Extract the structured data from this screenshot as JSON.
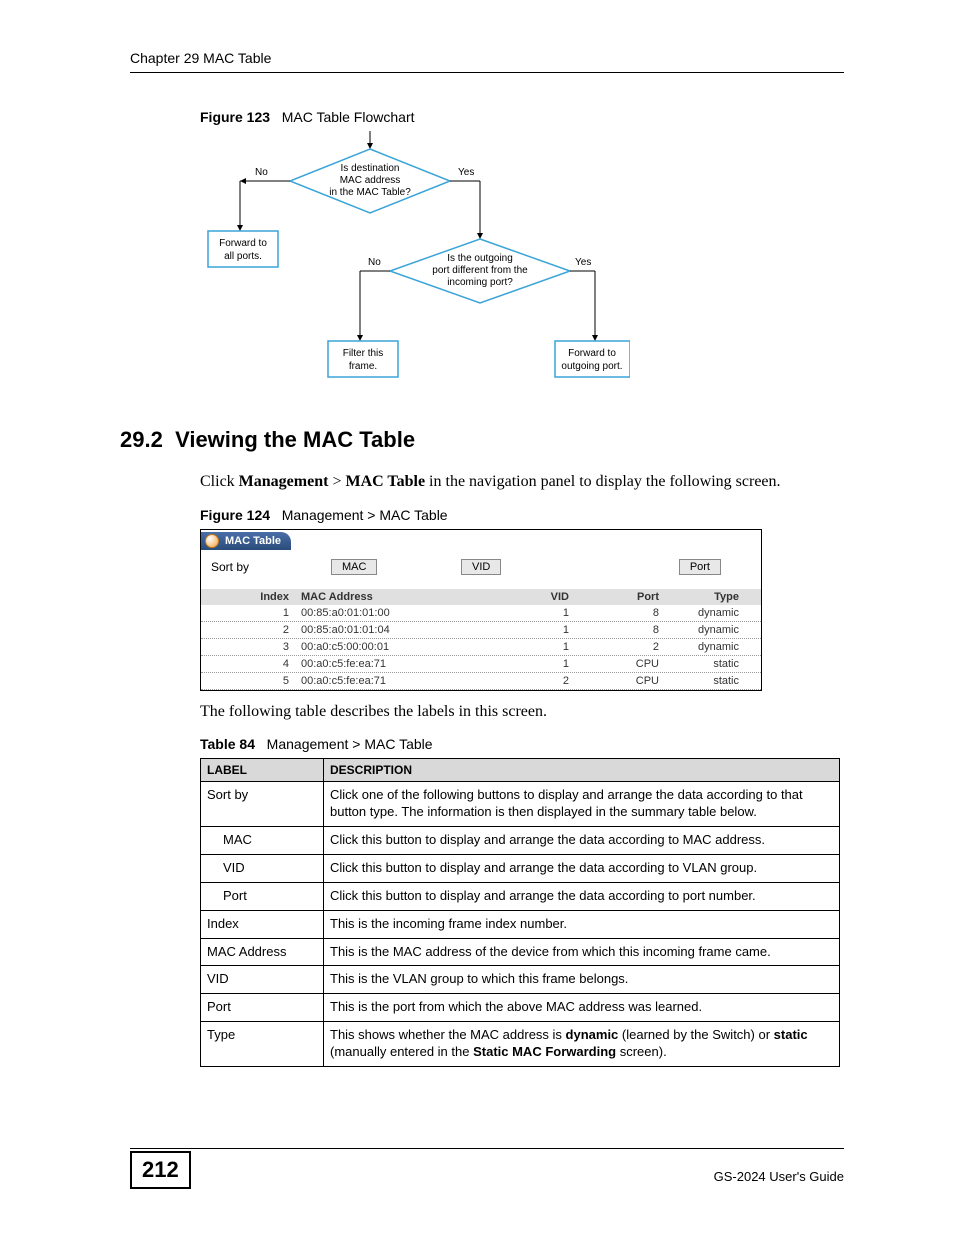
{
  "header": {
    "chapter": "Chapter 29 MAC Table"
  },
  "figure123": {
    "label": "Figure 123",
    "title": "MAC Table Flowchart",
    "decision1": "Is destination MAC address in the MAC Table?",
    "decision2": "Is the outgoing port different from the incoming port?",
    "no": "No",
    "yes": "Yes",
    "box_forward_all": "Forward to all ports.",
    "box_filter": "Filter this frame.",
    "box_forward_out": "Forward to outgoing port."
  },
  "section": {
    "number": "29.2",
    "title": "Viewing the MAC Table",
    "intro_pre": "Click ",
    "intro_b1": "Management",
    "intro_gt": " > ",
    "intro_b2": "MAC Table",
    "intro_post": " in the navigation panel to display the following screen."
  },
  "figure124": {
    "label": "Figure 124",
    "title": "Management > MAC Table",
    "tab": "MAC Table",
    "sortby": "Sort by",
    "buttons": {
      "mac": "MAC",
      "vid": "VID",
      "port": "Port"
    },
    "columns": [
      "Index",
      "MAC Address",
      "VID",
      "Port",
      "Type"
    ],
    "rows": [
      {
        "index": "1",
        "mac": "00:85:a0:01:01:00",
        "vid": "1",
        "port": "8",
        "type": "dynamic"
      },
      {
        "index": "2",
        "mac": "00:85:a0:01:01:04",
        "vid": "1",
        "port": "8",
        "type": "dynamic"
      },
      {
        "index": "3",
        "mac": "00:a0:c5:00:00:01",
        "vid": "1",
        "port": "2",
        "type": "dynamic"
      },
      {
        "index": "4",
        "mac": "00:a0:c5:fe:ea:71",
        "vid": "1",
        "port": "CPU",
        "type": "static"
      },
      {
        "index": "5",
        "mac": "00:a0:c5:fe:ea:71",
        "vid": "2",
        "port": "CPU",
        "type": "static"
      }
    ]
  },
  "post_fig_text": "The following table describes the labels in this screen.",
  "table84": {
    "label": "Table 84",
    "title": "Management > MAC Table",
    "head_label": "LABEL",
    "head_desc": "DESCRIPTION",
    "rows": [
      {
        "label": "Sort by",
        "desc": "Click one of the following buttons to display and arrange the data according to that button type. The information is then displayed in the summary table below.",
        "indent": false
      },
      {
        "label": "MAC",
        "desc": "Click this button to display and arrange the data according to MAC address.",
        "indent": true
      },
      {
        "label": "VID",
        "desc": "Click this button to display and arrange the data according to VLAN group.",
        "indent": true
      },
      {
        "label": "Port",
        "desc": "Click this button to display and arrange the data according to port number.",
        "indent": true
      },
      {
        "label": "Index",
        "desc": "This is the incoming frame index number.",
        "indent": false
      },
      {
        "label": "MAC Address",
        "desc": "This is the MAC address of the device from which this incoming frame came.",
        "indent": false
      },
      {
        "label": "VID",
        "desc": "This is the VLAN group to which this frame belongs.",
        "indent": false
      },
      {
        "label": "Port",
        "desc": "This is the port from which the above MAC address was learned.",
        "indent": false
      }
    ],
    "type_row": {
      "label": "Type",
      "pre": "This shows whether the MAC address is ",
      "b1": "dynamic",
      "mid1": " (learned by the Switch) or ",
      "b2": "static",
      "mid2": " (manually entered in the ",
      "b3": "Static MAC Forwarding",
      "post": " screen)."
    }
  },
  "footer": {
    "page": "212",
    "guide": "GS-2024 User's Guide"
  }
}
